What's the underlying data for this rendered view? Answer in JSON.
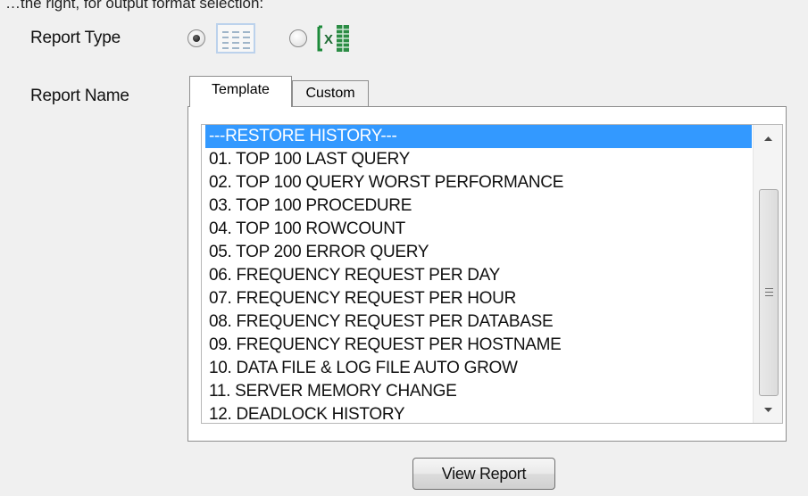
{
  "top_partial_text": "…the right, for output format selection:",
  "report_type": {
    "label": "Report Type",
    "options": [
      {
        "icon": "grid-report-icon",
        "selected": true
      },
      {
        "icon": "excel-icon",
        "icon_text": "X",
        "selected": false
      }
    ]
  },
  "report_name": {
    "label": "Report Name",
    "tabs": [
      {
        "label": "Template",
        "active": true
      },
      {
        "label": "Custom",
        "active": false
      }
    ],
    "items": [
      "---RESTORE HISTORY---",
      "01. TOP 100 LAST QUERY",
      "02. TOP 100 QUERY WORST PERFORMANCE",
      "03. TOP 100 PROCEDURE",
      "04. TOP 100 ROWCOUNT",
      "05. TOP 200 ERROR QUERY",
      "06. FREQUENCY REQUEST PER DAY",
      "07. FREQUENCY REQUEST PER HOUR",
      "08. FREQUENCY REQUEST PER DATABASE",
      "09. FREQUENCY REQUEST PER HOSTNAME",
      "10. DATA FILE & LOG FILE AUTO GROW",
      "11. SERVER MEMORY CHANGE",
      "12. DEADLOCK HISTORY"
    ],
    "selected_index": 0
  },
  "view_button": {
    "label": "View Report"
  },
  "colors": {
    "selection": "#3399ff",
    "window_bg": "#f0f0f0",
    "excel_green": "#1d8a3a"
  }
}
